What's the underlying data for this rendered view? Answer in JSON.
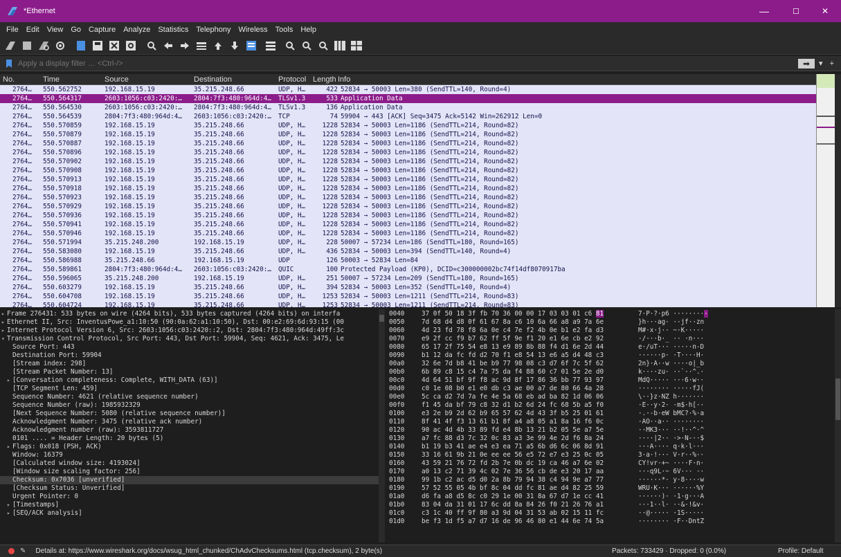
{
  "window": {
    "title": "*Ethernet",
    "min": "—",
    "max": "☐",
    "close": "✕"
  },
  "menu": [
    "File",
    "Edit",
    "View",
    "Go",
    "Capture",
    "Analyze",
    "Statistics",
    "Telephony",
    "Wireless",
    "Tools",
    "Help"
  ],
  "filter": {
    "placeholder": "Apply a display filter … <Ctrl-/>",
    "apply": "➡",
    "dropdown": "▾",
    "add": "+"
  },
  "columns": {
    "no": "No.",
    "time": "Time",
    "source": "Source",
    "destination": "Destination",
    "protocol": "Protocol",
    "length": "Length",
    "info": "Info"
  },
  "packets": [
    {
      "no": "2764…",
      "time": "550.562752",
      "src": "192.168.15.19",
      "dst": "35.215.248.66",
      "proto": "UDP, H…",
      "len": "422",
      "info": "52834 → 50003 Len=380 (SendTTL=140, Round=4)",
      "style": "udp"
    },
    {
      "no": "2764…",
      "time": "550.564317",
      "src": "2603:1056:c03:2420:…",
      "dst": "2804:7f3:480:964d:4…",
      "proto": "TLSv1.3",
      "len": "533",
      "info": "Application Data",
      "style": "sel"
    },
    {
      "no": "2764…",
      "time": "550.564530",
      "src": "2603:1056:c03:2420:…",
      "dst": "2804:7f3:480:964d:4…",
      "proto": "TLSv1.3",
      "len": "136",
      "info": "Application Data",
      "style": "udp"
    },
    {
      "no": "2764…",
      "time": "550.564539",
      "src": "2804:7f3:480:964d:4…",
      "dst": "2603:1056:c03:2420:…",
      "proto": "TCP",
      "len": "74",
      "info": "59904 → 443 [ACK] Seq=3475 Ack=5142 Win=262912 Len=0",
      "style": "udp"
    },
    {
      "no": "2764…",
      "time": "550.570859",
      "src": "192.168.15.19",
      "dst": "35.215.248.66",
      "proto": "UDP, H…",
      "len": "1228",
      "info": "52834 → 50003 Len=1186 (SendTTL=214, Round=82)",
      "style": "udp"
    },
    {
      "no": "2764…",
      "time": "550.570879",
      "src": "192.168.15.19",
      "dst": "35.215.248.66",
      "proto": "UDP, H…",
      "len": "1228",
      "info": "52834 → 50003 Len=1186 (SendTTL=214, Round=82)",
      "style": "udp"
    },
    {
      "no": "2764…",
      "time": "550.570887",
      "src": "192.168.15.19",
      "dst": "35.215.248.66",
      "proto": "UDP, H…",
      "len": "1228",
      "info": "52834 → 50003 Len=1186 (SendTTL=214, Round=82)",
      "style": "udp"
    },
    {
      "no": "2764…",
      "time": "550.570896",
      "src": "192.168.15.19",
      "dst": "35.215.248.66",
      "proto": "UDP, H…",
      "len": "1228",
      "info": "52834 → 50003 Len=1186 (SendTTL=214, Round=82)",
      "style": "udp"
    },
    {
      "no": "2764…",
      "time": "550.570902",
      "src": "192.168.15.19",
      "dst": "35.215.248.66",
      "proto": "UDP, H…",
      "len": "1228",
      "info": "52834 → 50003 Len=1186 (SendTTL=214, Round=82)",
      "style": "udp"
    },
    {
      "no": "2764…",
      "time": "550.570908",
      "src": "192.168.15.19",
      "dst": "35.215.248.66",
      "proto": "UDP, H…",
      "len": "1228",
      "info": "52834 → 50003 Len=1186 (SendTTL=214, Round=82)",
      "style": "udp"
    },
    {
      "no": "2764…",
      "time": "550.570913",
      "src": "192.168.15.19",
      "dst": "35.215.248.66",
      "proto": "UDP, H…",
      "len": "1228",
      "info": "52834 → 50003 Len=1186 (SendTTL=214, Round=82)",
      "style": "udp"
    },
    {
      "no": "2764…",
      "time": "550.570918",
      "src": "192.168.15.19",
      "dst": "35.215.248.66",
      "proto": "UDP, H…",
      "len": "1228",
      "info": "52834 → 50003 Len=1186 (SendTTL=214, Round=82)",
      "style": "udp"
    },
    {
      "no": "2764…",
      "time": "550.570923",
      "src": "192.168.15.19",
      "dst": "35.215.248.66",
      "proto": "UDP, H…",
      "len": "1228",
      "info": "52834 → 50003 Len=1186 (SendTTL=214, Round=82)",
      "style": "udp"
    },
    {
      "no": "2764…",
      "time": "550.570929",
      "src": "192.168.15.19",
      "dst": "35.215.248.66",
      "proto": "UDP, H…",
      "len": "1228",
      "info": "52834 → 50003 Len=1186 (SendTTL=214, Round=82)",
      "style": "udp"
    },
    {
      "no": "2764…",
      "time": "550.570936",
      "src": "192.168.15.19",
      "dst": "35.215.248.66",
      "proto": "UDP, H…",
      "len": "1228",
      "info": "52834 → 50003 Len=1186 (SendTTL=214, Round=82)",
      "style": "udp"
    },
    {
      "no": "2764…",
      "time": "550.570941",
      "src": "192.168.15.19",
      "dst": "35.215.248.66",
      "proto": "UDP, H…",
      "len": "1228",
      "info": "52834 → 50003 Len=1186 (SendTTL=214, Round=82)",
      "style": "udp"
    },
    {
      "no": "2764…",
      "time": "550.570946",
      "src": "192.168.15.19",
      "dst": "35.215.248.66",
      "proto": "UDP, H…",
      "len": "1228",
      "info": "52834 → 50003 Len=1186 (SendTTL=214, Round=82)",
      "style": "udp"
    },
    {
      "no": "2764…",
      "time": "550.571994",
      "src": "35.215.248.200",
      "dst": "192.168.15.19",
      "proto": "UDP, H…",
      "len": "228",
      "info": "50007 → 57234 Len=186 (SendTTL=180, Round=165)",
      "style": "udp"
    },
    {
      "no": "2764…",
      "time": "550.583080",
      "src": "192.168.15.19",
      "dst": "35.215.248.66",
      "proto": "UDP, H…",
      "len": "436",
      "info": "52834 → 50003 Len=394 (SendTTL=140, Round=4)",
      "style": "udp"
    },
    {
      "no": "2764…",
      "time": "550.586988",
      "src": "35.215.248.66",
      "dst": "192.168.15.19",
      "proto": "UDP",
      "len": "126",
      "info": "50003 → 52834 Len=84",
      "style": "udp"
    },
    {
      "no": "2764…",
      "time": "550.589861",
      "src": "2804:7f3:480:964d:4…",
      "dst": "2603:1056:c03:2420:…",
      "proto": "QUIC",
      "len": "100",
      "info": "Protected Payload (KP0), DCID=c300000002bc74f14df8070917ba",
      "style": "udp"
    },
    {
      "no": "2764…",
      "time": "550.596065",
      "src": "35.215.248.200",
      "dst": "192.168.15.19",
      "proto": "UDP, H…",
      "len": "251",
      "info": "50007 → 57234 Len=209 (SendTTL=180, Round=165)",
      "style": "udp"
    },
    {
      "no": "2764…",
      "time": "550.603279",
      "src": "192.168.15.19",
      "dst": "35.215.248.66",
      "proto": "UDP, H…",
      "len": "394",
      "info": "52834 → 50003 Len=352 (SendTTL=140, Round=4)",
      "style": "udp"
    },
    {
      "no": "2764…",
      "time": "550.604708",
      "src": "192.168.15.19",
      "dst": "35.215.248.66",
      "proto": "UDP, H…",
      "len": "1253",
      "info": "52834 → 50003 Len=1211 (SendTTL=214, Round=83)",
      "style": "udp"
    },
    {
      "no": "2764…",
      "time": "550.604724",
      "src": "192.168.15.19",
      "dst": "35.215.248.66",
      "proto": "UDP, H…",
      "len": "1253",
      "info": "52834 → 50003 Len=1211 (SendTTL=214, Round=83)",
      "style": "udp"
    }
  ],
  "details": [
    {
      "text": "Frame 276431: 533 bytes on wire (4264 bits), 533 bytes captured (4264 bits) on interfa",
      "arrow": "▸",
      "indent": 0
    },
    {
      "text": "Ethernet II, Src: InventusPowe_a1:10:50 (90:0a:62:a1:10:50), Dst: 00:e2:69:6d:93:15 (00",
      "arrow": "▸",
      "indent": 0
    },
    {
      "text": "Internet Protocol Version 6, Src: 2603:1056:c03:2420::2, Dst: 2804:7f3:480:964d:49ff:3c",
      "arrow": "▸",
      "indent": 0
    },
    {
      "text": "Transmission Control Protocol, Src Port: 443, Dst Port: 59904, Seq: 4621, Ack: 3475, Le",
      "arrow": "▾",
      "indent": 0
    },
    {
      "text": "Source Port: 443",
      "arrow": "",
      "indent": 1
    },
    {
      "text": "Destination Port: 59904",
      "arrow": "",
      "indent": 1
    },
    {
      "text": "[Stream index: 298]",
      "arrow": "",
      "indent": 1
    },
    {
      "text": "[Stream Packet Number: 13]",
      "arrow": "",
      "indent": 1
    },
    {
      "text": "[Conversation completeness: Complete, WITH_DATA (63)]",
      "arrow": "▸",
      "indent": 1
    },
    {
      "text": "[TCP Segment Len: 459]",
      "arrow": "",
      "indent": 1
    },
    {
      "text": "Sequence Number: 4621    (relative sequence number)",
      "arrow": "",
      "indent": 1
    },
    {
      "text": "Sequence Number (raw): 1985932329",
      "arrow": "",
      "indent": 1
    },
    {
      "text": "[Next Sequence Number: 5080    (relative sequence number)]",
      "arrow": "",
      "indent": 1
    },
    {
      "text": "Acknowledgment Number: 3475    (relative ack number)",
      "arrow": "",
      "indent": 1
    },
    {
      "text": "Acknowledgment number (raw): 3593811727",
      "arrow": "",
      "indent": 1
    },
    {
      "text": "0101 .... = Header Length: 20 bytes (5)",
      "arrow": "",
      "indent": 1
    },
    {
      "text": "Flags: 0x018 (PSH, ACK)",
      "arrow": "▸",
      "indent": 1
    },
    {
      "text": "Window: 16379",
      "arrow": "",
      "indent": 1
    },
    {
      "text": "[Calculated window size: 4193024]",
      "arrow": "",
      "indent": 1
    },
    {
      "text": "[Window size scaling factor: 256]",
      "arrow": "",
      "indent": 1
    },
    {
      "text": "Checksum: 0x7036 [unverified]",
      "arrow": "",
      "indent": 1,
      "sel": true
    },
    {
      "text": "[Checksum Status: Unverified]",
      "arrow": "",
      "indent": 1
    },
    {
      "text": "Urgent Pointer: 0",
      "arrow": "",
      "indent": 1
    },
    {
      "text": "[Timestamps]",
      "arrow": "▸",
      "indent": 1
    },
    {
      "text": "[SEQ/ACK analysis]",
      "arrow": "▸",
      "indent": 1
    }
  ],
  "hex": [
    {
      "off": "0040",
      "hex": "37 0f 50 18 3f fb 70 36  00 00 17 03 03 01 c6 ",
      "hl": "81",
      "asc": "7·P·?·p6 ········",
      "aschl": "·"
    },
    {
      "off": "0050",
      "hex": "7d 68 d4 d8 0f 61 67 8a  c6 10 6a 66 a8 a9 7a 6e",
      "hl": "",
      "asc": "}h···ag· ··jf··zn",
      "aschl": ""
    },
    {
      "off": "0060",
      "hex": "4d 23 fd 78 f8 6a 0e c4  7e f2 4b 0e b1 e2 fa d3",
      "hl": "",
      "asc": "M#·x·j·· ~·K·····",
      "aschl": ""
    },
    {
      "off": "0070",
      "hex": "e9 2f cc f9 b7 62 ff 5f  9e f1 20 e1 6e cb e2 92",
      "hl": "",
      "asc": "·/···b·_ ·· ·n···",
      "aschl": ""
    },
    {
      "off": "0080",
      "hex": "65 17 2f 75 54 e8 13 e9  89 8b 88 f4 d1 6e 2d 44",
      "hl": "",
      "asc": "e·/uT··· ·····n-D",
      "aschl": ""
    },
    {
      "off": "0090",
      "hex": "b1 12 da fc fd d2 70 f1  e8 54 13 e6 a5 d4 48 c3",
      "hl": "",
      "asc": "······p· ·T····H·",
      "aschl": ""
    },
    {
      "off": "00a0",
      "hex": "32 6e 7d b8 41 be b9 77  98 08 c3 d7 6f 7c 5f 62",
      "hl": "",
      "asc": "2n}·A··w ····o|_b",
      "aschl": ""
    },
    {
      "off": "00b0",
      "hex": "6b 89 c8 15 c4 7a 75 da  f4 88 60 c7 01 5e 2e d0",
      "hl": "",
      "asc": "k····zu· ··`··^.·",
      "aschl": ""
    },
    {
      "off": "00c0",
      "hex": "4d 64 51 bf 9f f8 ac 9d  8f 17 86 36 bb 77 93 97",
      "hl": "",
      "asc": "MdQ····· ···6·w··",
      "aschl": ""
    },
    {
      "off": "00d0",
      "hex": "c0 1e 08 b0 e1 e0 db c3  ae 00 a7 de 80 66 4a 28",
      "hl": "",
      "asc": "········ ·····fJ(",
      "aschl": ""
    },
    {
      "off": "00e0",
      "hex": "5c ca d2 7d 7a fe 4e 5a  68 eb ad ba 82 1d 06 06",
      "hl": "",
      "asc": "\\··}z·NZ h·······",
      "aschl": ""
    },
    {
      "off": "00f0",
      "hex": "f1 45 da bf 79 c8 32 d1  b2 6d 24 fc 68 5b a5 f0",
      "hl": "",
      "asc": "·E··y·2· ·m$·h[··",
      "aschl": ""
    },
    {
      "off": "0100",
      "hex": "e3 2e b9 2d 62 b9 65 57  62 4d 43 3f b5 25 01 61",
      "hl": "",
      "asc": "·.·-b·eW bMC?·%·a",
      "aschl": ""
    },
    {
      "off": "0110",
      "hex": "8f 41 4f f3 13 61 b1 8f  a4 a8 05 a1 8a 16 f6 0c",
      "hl": "",
      "asc": "·AO··a·· ········",
      "aschl": ""
    },
    {
      "off": "0120",
      "hex": "90 ac 4d 4b 33 89 fd e4  8b 13 21 b2 05 5e a7 5e",
      "hl": "",
      "asc": "··MK3··· ··!··^·^",
      "aschl": ""
    },
    {
      "off": "0130",
      "hex": "a7 fc 88 d3 7c 32 0c 83  a3 3e 99 4e 2d f6 8a 24",
      "hl": "",
      "asc": "····|2·· ·>·N-··$",
      "aschl": ""
    },
    {
      "off": "0140",
      "hex": "b1 19 b3 41 ae e4 e3 ea  71 a5 6b d6 6c 06 8d 91",
      "hl": "",
      "asc": "···A···· q·k·l···",
      "aschl": ""
    },
    {
      "off": "0150",
      "hex": "33 16 61 9b 21 0e ee ee  56 e5 72 e7 e3 25 0c 05",
      "hl": "",
      "asc": "3·a·!··· V·r··%··",
      "aschl": ""
    },
    {
      "off": "0160",
      "hex": "43 59 21 76 72 fd 2b 7e  0b dc 19 ca 46 a7 6e 02",
      "hl": "",
      "asc": "CY!vr·+~ ····F·n·",
      "aschl": ""
    },
    {
      "off": "0170",
      "hex": "a0 13 c2 71 39 4c 02 7e  36 56 cb de e3 20 17 aa",
      "hl": "",
      "asc": "···q9L·~ 6V··· ··",
      "aschl": ""
    },
    {
      "off": "0180",
      "hex": "99 1b c2 ac d5 d0 2a 8b  79 94 38 c4 94 9e a7 77",
      "hl": "",
      "asc": "······*· y·8····w",
      "aschl": ""
    },
    {
      "off": "0190",
      "hex": "57 52 55 05 4b bf 8c 04  dd fc 81 ae d4 82 25 59",
      "hl": "",
      "asc": "WRU·K··· ······%Y",
      "aschl": ""
    },
    {
      "off": "01a0",
      "hex": "d6 fa a8 d5 8c c0 29 1e  00 31 8a 67 d7 1e cc 41",
      "hl": "",
      "asc": "······)· ·1·g···A",
      "aschl": ""
    },
    {
      "off": "01b0",
      "hex": "83 04 da 31 01 17 6c dd  8a 84 26 f0 21 26 76 a1",
      "hl": "",
      "asc": "···1··l· ··&·!&v·",
      "aschl": ""
    },
    {
      "off": "01c0",
      "hex": "c3 1c 40 ff 9f 80 a3 9d  04 31 53 ab 02 15 11 fc",
      "hl": "",
      "asc": "··@····· ·1S·····",
      "aschl": ""
    },
    {
      "off": "01d0",
      "hex": "be f3 1d f5 a7 d7 16 de  96 46 80 e1 44 6e 74 5a",
      "hl": "",
      "asc": "········ ·F··DntZ",
      "aschl": ""
    }
  ],
  "status": {
    "details": "Details at: https://www.wireshark.org/docs/wsug_html_chunked/ChAdvChecksums.html (tcp.checksum), 2 byte(s)",
    "packets": "Packets: 733429 · Dropped: 0 (0.0%)",
    "profile": "Profile: Default"
  },
  "colors": {
    "accent": "#8b1c8a",
    "row": "#e4e4f8",
    "dark": "#1e1e1e"
  }
}
